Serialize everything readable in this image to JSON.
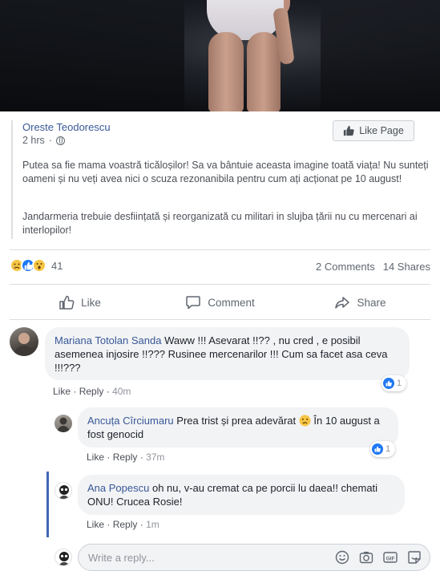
{
  "post": {
    "author": "Oreste Teodorescu",
    "time": "2 hrs",
    "like_page_label": "Like Page",
    "paragraph1": "Putea sa fie mama voastră ticăloșilor! Sa va bântuie aceasta imagine toată viața! Nu sunteți oameni și nu veți avea nici o scuza rezonanibila pentru cum ați acționat pe 10 august!",
    "paragraph2": "Jandarmeria trebuie desființată și reorganizată cu militari in slujba țării nu cu mercenari ai interlopilor!"
  },
  "reactions": {
    "count": "41",
    "comments": "2 Comments",
    "shares": "14 Shares"
  },
  "actions": {
    "like": "Like",
    "comment": "Comment",
    "share": "Share"
  },
  "comments": [
    {
      "author": "Mariana Totolan Sanda",
      "text": "Waww !!! Asevarat !!?? , nu cred , e posibil asemenea injosire !!??? Rusinee mercenarilor !!! Cum sa facet asa ceva !!!???",
      "like": "Like",
      "reply": "Reply",
      "time": "40m",
      "likes": "1"
    },
    {
      "author": "Ancuța Cîrciumaru",
      "text_before": "Prea trist și prea adevărat",
      "text_after": "În 10 august a fost genocid",
      "like": "Like",
      "reply": "Reply",
      "time": "37m",
      "likes": "1"
    },
    {
      "author": "Ana Popescu",
      "text": "oh nu, v-au cremat ca pe porcii lu daea!! chemati ONU! Crucea Rosie!",
      "like": "Like",
      "reply": "Reply",
      "time": "1m"
    }
  ],
  "reply_box": {
    "placeholder": "Write a reply..."
  },
  "icons": [
    "thumbs-up-icon",
    "globe-icon",
    "comment-icon",
    "share-icon",
    "emoji-icon",
    "camera-icon",
    "gif-icon",
    "sticker-icon"
  ],
  "colors": {
    "link": "#385898",
    "like_blue": "#2078f4",
    "bubble": "#f2f3f5",
    "thread": "#4267b2"
  }
}
